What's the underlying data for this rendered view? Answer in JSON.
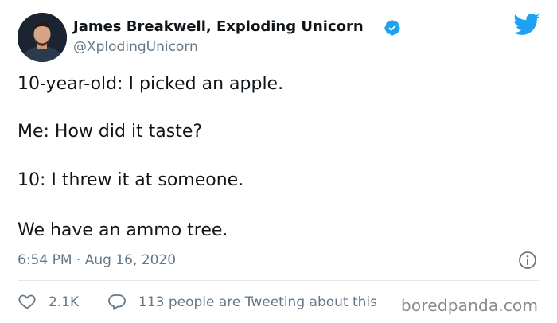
{
  "author": {
    "name": "James Breakwell, Exploding Unicorn",
    "handle": "@XplodingUnicorn",
    "verified_icon": "verified-badge-icon"
  },
  "tweet": {
    "lines": [
      "10-year-old: I picked an apple.",
      "Me: How did it taste?",
      "10: I threw it at someone.",
      "We have an ammo tree."
    ],
    "timestamp": "6:54 PM · Aug 16, 2020"
  },
  "actions": {
    "likes": "2.1K",
    "tweeting": "113 people are Tweeting about this"
  },
  "watermark": "boredpanda.com",
  "colors": {
    "twitter_blue": "#1da1f2",
    "muted_text": "#657786",
    "text": "#0f1419",
    "divider": "#e1e8ed"
  },
  "icons": {
    "brand": "twitter-bird-icon",
    "info": "info-icon",
    "like": "heart-icon",
    "reply": "speech-bubble-icon"
  }
}
